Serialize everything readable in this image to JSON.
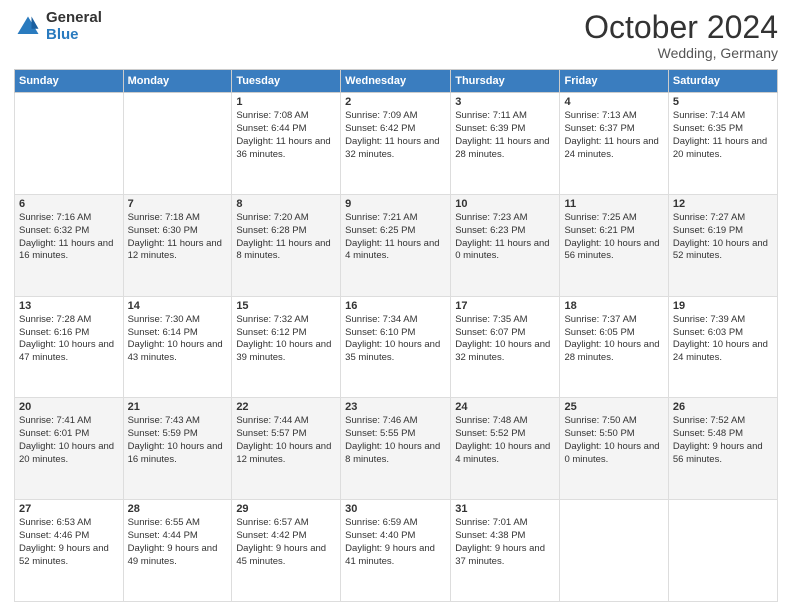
{
  "header": {
    "logo_general": "General",
    "logo_blue": "Blue",
    "month_title": "October 2024",
    "location": "Wedding, Germany"
  },
  "days_of_week": [
    "Sunday",
    "Monday",
    "Tuesday",
    "Wednesday",
    "Thursday",
    "Friday",
    "Saturday"
  ],
  "weeks": [
    [
      {
        "day": "",
        "info": ""
      },
      {
        "day": "",
        "info": ""
      },
      {
        "day": "1",
        "info": "Sunrise: 7:08 AM\nSunset: 6:44 PM\nDaylight: 11 hours and 36 minutes."
      },
      {
        "day": "2",
        "info": "Sunrise: 7:09 AM\nSunset: 6:42 PM\nDaylight: 11 hours and 32 minutes."
      },
      {
        "day": "3",
        "info": "Sunrise: 7:11 AM\nSunset: 6:39 PM\nDaylight: 11 hours and 28 minutes."
      },
      {
        "day": "4",
        "info": "Sunrise: 7:13 AM\nSunset: 6:37 PM\nDaylight: 11 hours and 24 minutes."
      },
      {
        "day": "5",
        "info": "Sunrise: 7:14 AM\nSunset: 6:35 PM\nDaylight: 11 hours and 20 minutes."
      }
    ],
    [
      {
        "day": "6",
        "info": "Sunrise: 7:16 AM\nSunset: 6:32 PM\nDaylight: 11 hours and 16 minutes."
      },
      {
        "day": "7",
        "info": "Sunrise: 7:18 AM\nSunset: 6:30 PM\nDaylight: 11 hours and 12 minutes."
      },
      {
        "day": "8",
        "info": "Sunrise: 7:20 AM\nSunset: 6:28 PM\nDaylight: 11 hours and 8 minutes."
      },
      {
        "day": "9",
        "info": "Sunrise: 7:21 AM\nSunset: 6:25 PM\nDaylight: 11 hours and 4 minutes."
      },
      {
        "day": "10",
        "info": "Sunrise: 7:23 AM\nSunset: 6:23 PM\nDaylight: 11 hours and 0 minutes."
      },
      {
        "day": "11",
        "info": "Sunrise: 7:25 AM\nSunset: 6:21 PM\nDaylight: 10 hours and 56 minutes."
      },
      {
        "day": "12",
        "info": "Sunrise: 7:27 AM\nSunset: 6:19 PM\nDaylight: 10 hours and 52 minutes."
      }
    ],
    [
      {
        "day": "13",
        "info": "Sunrise: 7:28 AM\nSunset: 6:16 PM\nDaylight: 10 hours and 47 minutes."
      },
      {
        "day": "14",
        "info": "Sunrise: 7:30 AM\nSunset: 6:14 PM\nDaylight: 10 hours and 43 minutes."
      },
      {
        "day": "15",
        "info": "Sunrise: 7:32 AM\nSunset: 6:12 PM\nDaylight: 10 hours and 39 minutes."
      },
      {
        "day": "16",
        "info": "Sunrise: 7:34 AM\nSunset: 6:10 PM\nDaylight: 10 hours and 35 minutes."
      },
      {
        "day": "17",
        "info": "Sunrise: 7:35 AM\nSunset: 6:07 PM\nDaylight: 10 hours and 32 minutes."
      },
      {
        "day": "18",
        "info": "Sunrise: 7:37 AM\nSunset: 6:05 PM\nDaylight: 10 hours and 28 minutes."
      },
      {
        "day": "19",
        "info": "Sunrise: 7:39 AM\nSunset: 6:03 PM\nDaylight: 10 hours and 24 minutes."
      }
    ],
    [
      {
        "day": "20",
        "info": "Sunrise: 7:41 AM\nSunset: 6:01 PM\nDaylight: 10 hours and 20 minutes."
      },
      {
        "day": "21",
        "info": "Sunrise: 7:43 AM\nSunset: 5:59 PM\nDaylight: 10 hours and 16 minutes."
      },
      {
        "day": "22",
        "info": "Sunrise: 7:44 AM\nSunset: 5:57 PM\nDaylight: 10 hours and 12 minutes."
      },
      {
        "day": "23",
        "info": "Sunrise: 7:46 AM\nSunset: 5:55 PM\nDaylight: 10 hours and 8 minutes."
      },
      {
        "day": "24",
        "info": "Sunrise: 7:48 AM\nSunset: 5:52 PM\nDaylight: 10 hours and 4 minutes."
      },
      {
        "day": "25",
        "info": "Sunrise: 7:50 AM\nSunset: 5:50 PM\nDaylight: 10 hours and 0 minutes."
      },
      {
        "day": "26",
        "info": "Sunrise: 7:52 AM\nSunset: 5:48 PM\nDaylight: 9 hours and 56 minutes."
      }
    ],
    [
      {
        "day": "27",
        "info": "Sunrise: 6:53 AM\nSunset: 4:46 PM\nDaylight: 9 hours and 52 minutes."
      },
      {
        "day": "28",
        "info": "Sunrise: 6:55 AM\nSunset: 4:44 PM\nDaylight: 9 hours and 49 minutes."
      },
      {
        "day": "29",
        "info": "Sunrise: 6:57 AM\nSunset: 4:42 PM\nDaylight: 9 hours and 45 minutes."
      },
      {
        "day": "30",
        "info": "Sunrise: 6:59 AM\nSunset: 4:40 PM\nDaylight: 9 hours and 41 minutes."
      },
      {
        "day": "31",
        "info": "Sunrise: 7:01 AM\nSunset: 4:38 PM\nDaylight: 9 hours and 37 minutes."
      },
      {
        "day": "",
        "info": ""
      },
      {
        "day": "",
        "info": ""
      }
    ]
  ]
}
